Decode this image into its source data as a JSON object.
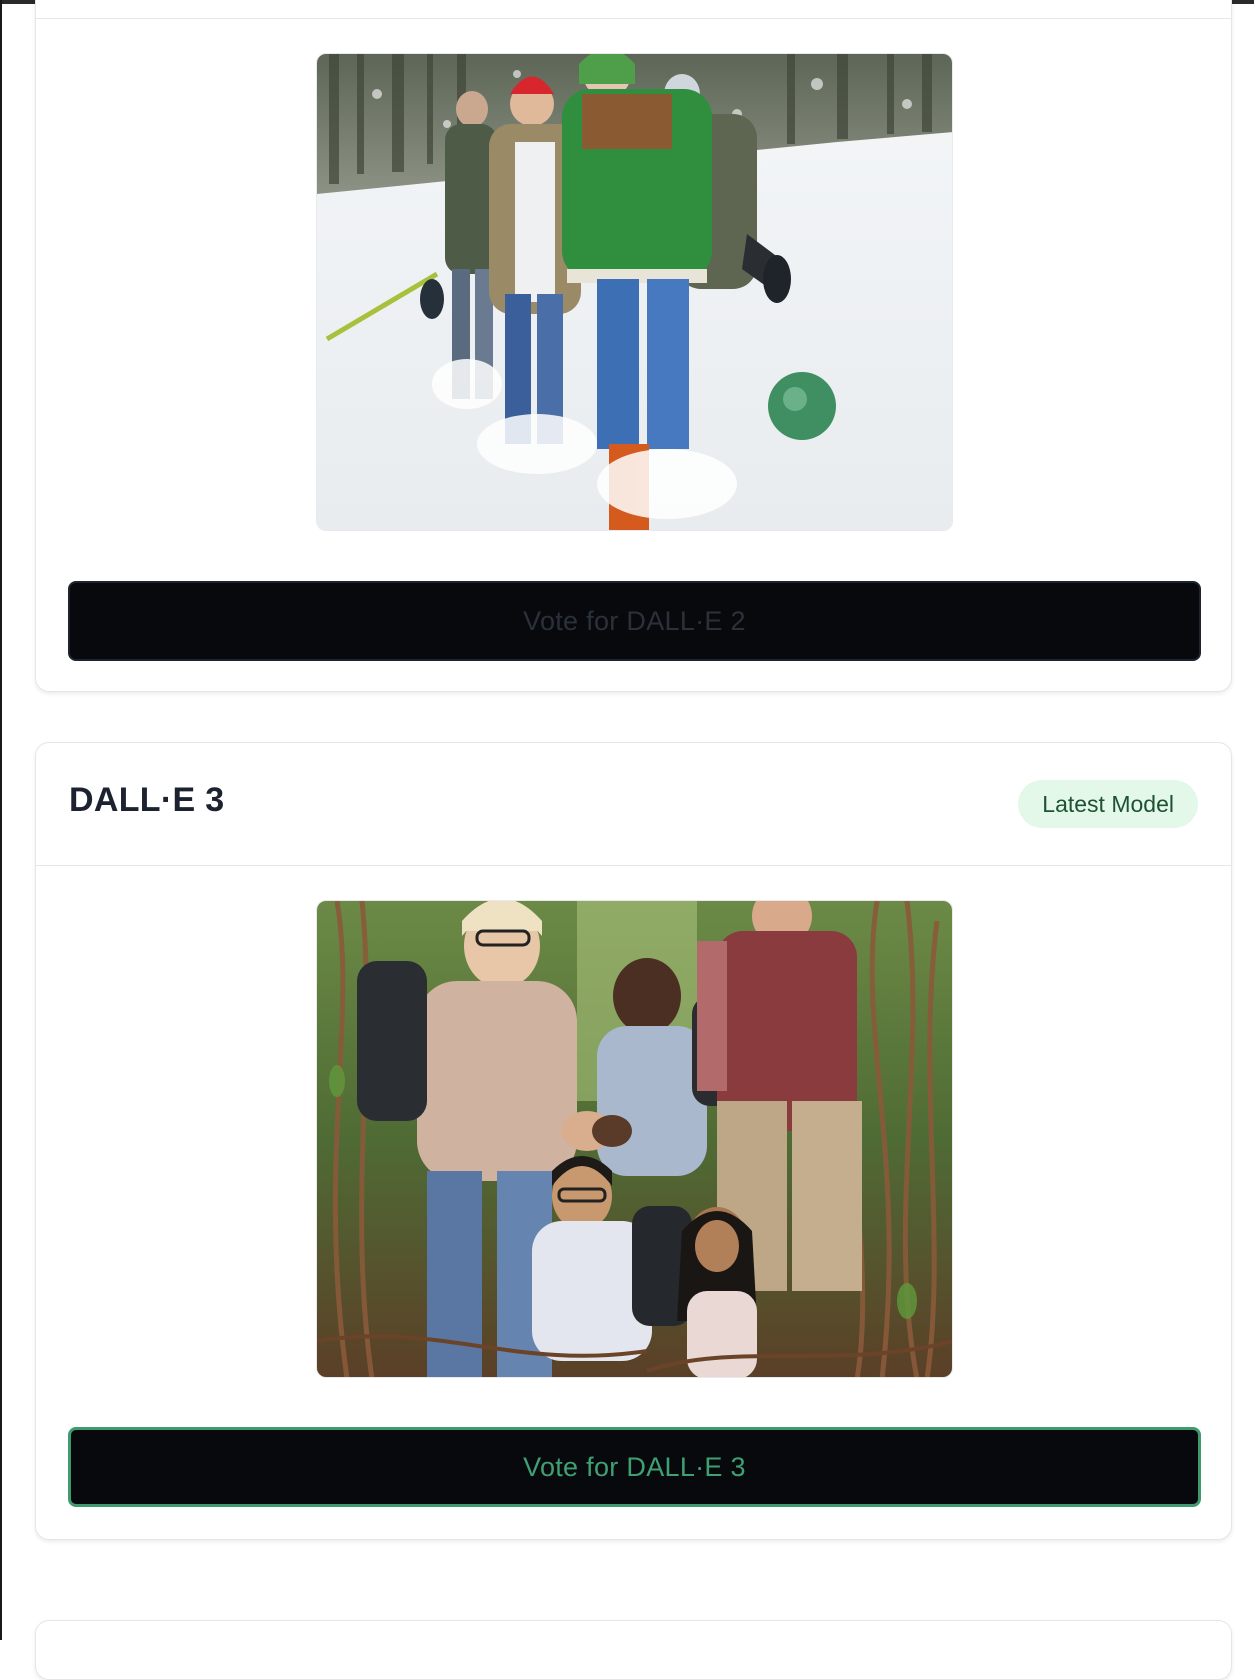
{
  "cards": [
    {
      "model": "DALL·E 2",
      "image_alt": "Group of hikers walking through deep snow in winter jackets",
      "vote_label": "Vote for DALL·E 2",
      "vote_state": "disabled"
    },
    {
      "model": "DALL·E 3",
      "badge": "Latest Model",
      "image_alt": "Group of diverse hikers helping each other through a jungle of vines",
      "vote_label": "Vote for DALL·E 3",
      "vote_state": "active"
    }
  ],
  "colors": {
    "button_bg": "#08090c",
    "accent_green": "#3ea073",
    "badge_bg": "#e3f8e9",
    "badge_text": "#1f5133"
  }
}
